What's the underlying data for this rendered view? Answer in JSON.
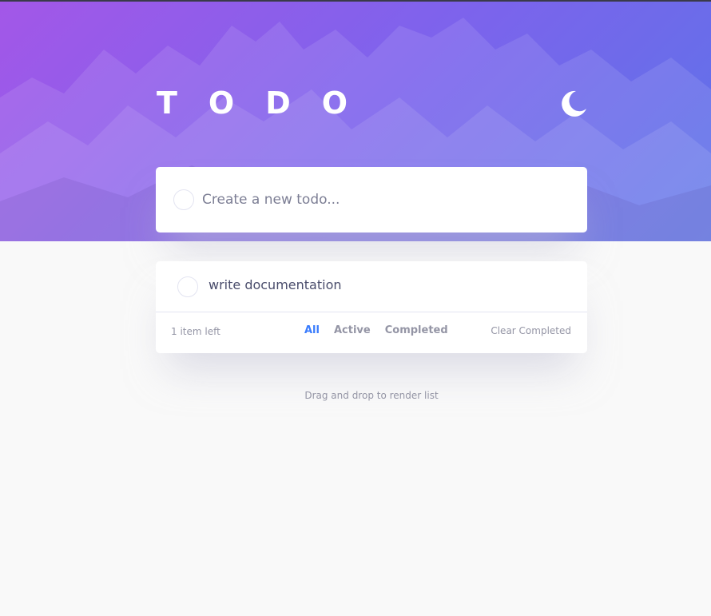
{
  "header": {
    "title": "TODO",
    "theme_toggle_icon": "moon-icon",
    "gradient": [
      "#a357e8",
      "#5b74e8"
    ]
  },
  "new_todo": {
    "placeholder": "Create a new todo...",
    "value": ""
  },
  "todos": [
    {
      "text": "write documentation",
      "completed": false
    }
  ],
  "footer": {
    "items_left": "1 item left",
    "filters": [
      "All",
      "Active",
      "Completed"
    ],
    "active_filter": "All",
    "clear_label": "Clear Completed"
  },
  "hint": "Drag and drop to render list",
  "colors": {
    "accent": "#3a7cfd",
    "text": "#494c6b",
    "muted": "#9495a5",
    "background": "#f9f9f9"
  }
}
